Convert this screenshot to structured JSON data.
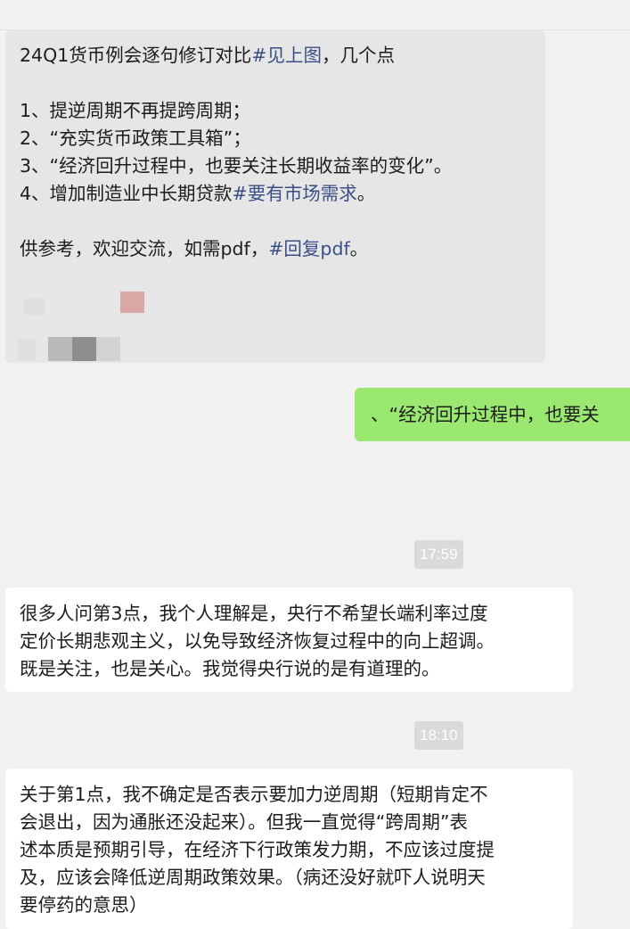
{
  "chat": {
    "messages": [
      {
        "direction": "incoming",
        "lines": [
          {
            "text": "24Q1货币例会逐句修订对比",
            "link": "#见上图",
            "after": "，几个点"
          },
          {
            "text": ""
          },
          {
            "text": "1、提逆周期不再提跨周期；"
          },
          {
            "text": "2、“充实货币政策工具箱”；"
          },
          {
            "text": "3、“经济回升过程中，也要关注长期收益率的变化”。"
          },
          {
            "text": "4、增加制造业中长期贷款",
            "link": "#要有市场需求",
            "after": "。"
          },
          {
            "text": ""
          },
          {
            "text": "供参考，欢迎交流，如需pdf，",
            "link": "#回复pdf",
            "after": "。"
          }
        ]
      },
      {
        "direction": "outgoing",
        "text": "、“经济回升过程中，也要关"
      },
      {
        "direction": "incoming",
        "timestamp": "17:59",
        "lines": [
          "很多人问第3点，我个人理解是，央行不希望长端利率过度",
          "定价长期悲观主义，以免导致经济恢复过程中的向上超调。",
          "既是关注，也是关心。我觉得央行说的是有道理的。"
        ]
      },
      {
        "direction": "incoming",
        "timestamp": "18:10",
        "lines": [
          "关于第1点，我不确定是否表示要加力逆周期（短期肯定不",
          "会退出，因为通胀还没起来）。但我一直觉得“跨周期”表",
          "述本质是预期引导，在经济下行政策发力期，不应该过度提",
          "及，应该会降低逆周期政策效果。（病还没好就吓人说明天",
          "要停药的意思）"
        ]
      }
    ]
  },
  "colors": {
    "background": "#f1f1f1",
    "incoming_quoted": "#e6e6e6",
    "incoming": "#ffffff",
    "outgoing": "#9be870",
    "link": "#3a4f86",
    "timestamp_bg": "#dadada"
  }
}
